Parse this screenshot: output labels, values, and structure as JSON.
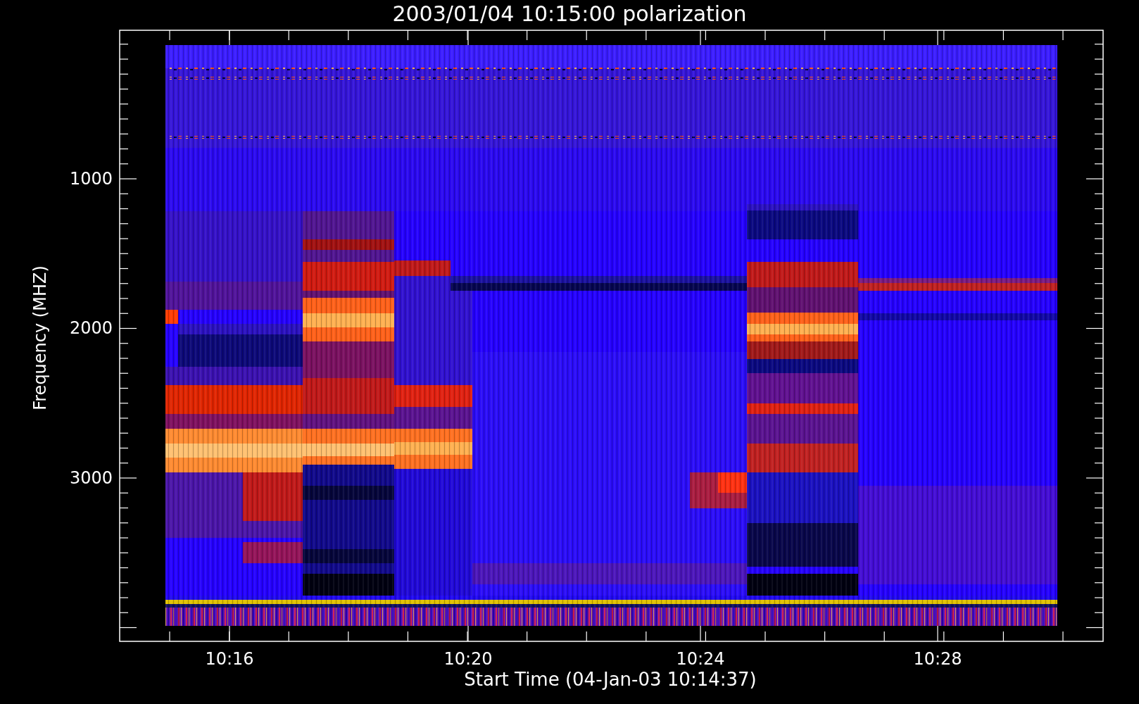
{
  "title": "2003/01/04 10:15:00 polarization",
  "y_axis": {
    "label": "Frequency (MHZ)",
    "ticks": [
      "1000",
      "2000",
      "3000"
    ]
  },
  "x_axis": {
    "label": "Start Time (04-Jan-03 10:14:37)",
    "ticks": [
      "10:16",
      "10:20",
      "10:24",
      "10:28"
    ]
  }
}
